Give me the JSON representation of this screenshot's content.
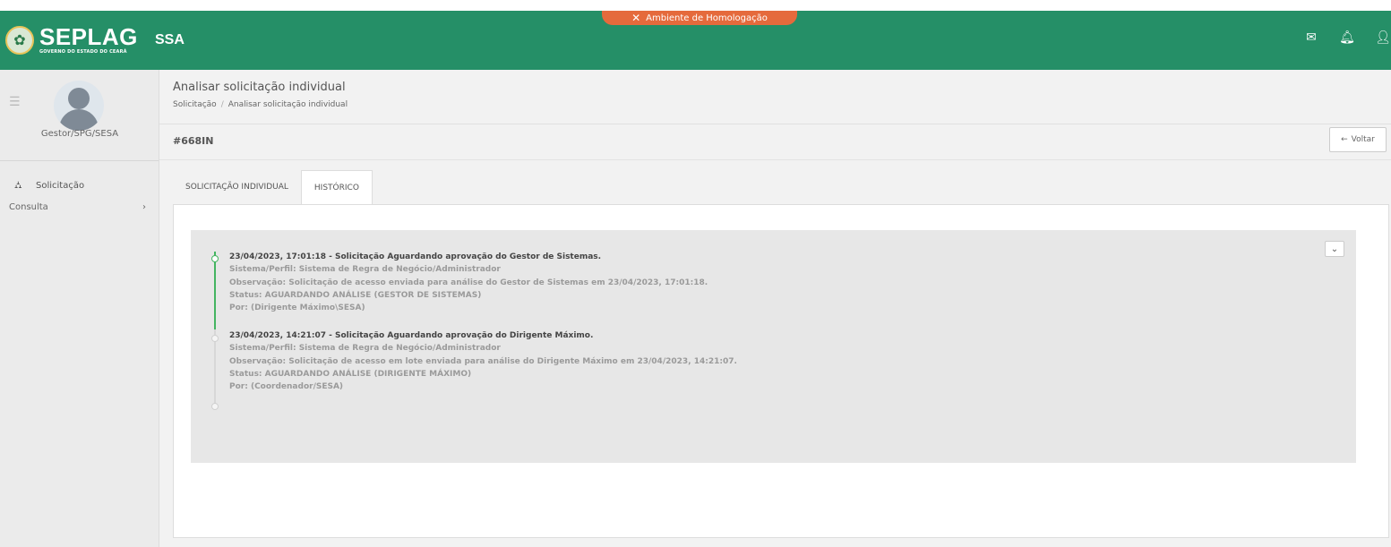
{
  "env_banner": {
    "label": "Ambiente de Homologação",
    "icon": "tools-icon",
    "color": "#e56a3c"
  },
  "header": {
    "logo_title": "SEPLAG",
    "logo_subtitle": "GOVERNO DO ESTADO DO CEARÁ",
    "app_name": "SSA",
    "color": "#258f67",
    "icons": [
      "mail-icon",
      "bell-icon",
      "user-icon"
    ]
  },
  "sidebar": {
    "profile_name": "Gestor/SPG/SESA",
    "items": [
      {
        "label": "Solicitação",
        "icon": "sitemap-icon"
      }
    ],
    "sub_items": [
      {
        "label": "Consulta",
        "chevron": "›"
      }
    ]
  },
  "page": {
    "title": "Analisar solicitação individual",
    "breadcrumb": [
      "Solicitação",
      "Analisar solicitação individual"
    ],
    "breadcrumb_sep": "/",
    "request_id": "#668IN",
    "back_label": "Voltar",
    "back_icon": "←"
  },
  "tabs": [
    {
      "label": "SOLICITAÇÃO INDIVIDUAL",
      "active": false
    },
    {
      "label": "HISTÓRICO",
      "active": true
    }
  ],
  "history": {
    "collapse_icon": "⌄",
    "entries": [
      {
        "head": "23/04/2023, 17:01:18 - Solicitação Aguardando aprovação do Gestor de Sistemas.",
        "lines": [
          "Sistema/Perfil: Sistema de Regra de Negócio/Administrador",
          "Observação: Solicitação de acesso enviada para análise do Gestor de Sistemas em 23/04/2023, 17:01:18.",
          "Status: AGUARDANDO ANÁLISE (GESTOR DE SISTEMAS)",
          "Por: (Dirigente Máximo\\SESA)"
        ]
      },
      {
        "head": "23/04/2023, 14:21:07 - Solicitação Aguardando aprovação do Dirigente Máximo.",
        "lines": [
          "Sistema/Perfil: Sistema de Regra de Negócio/Administrador",
          "Observação: Solicitação de acesso em lote enviada para análise do Dirigente Máximo em 23/04/2023, 14:21:07.",
          "Status: AGUARDANDO ANÁLISE (DIRIGENTE MÁXIMO)",
          "Por: (Coordenador/SESA)"
        ]
      }
    ]
  }
}
